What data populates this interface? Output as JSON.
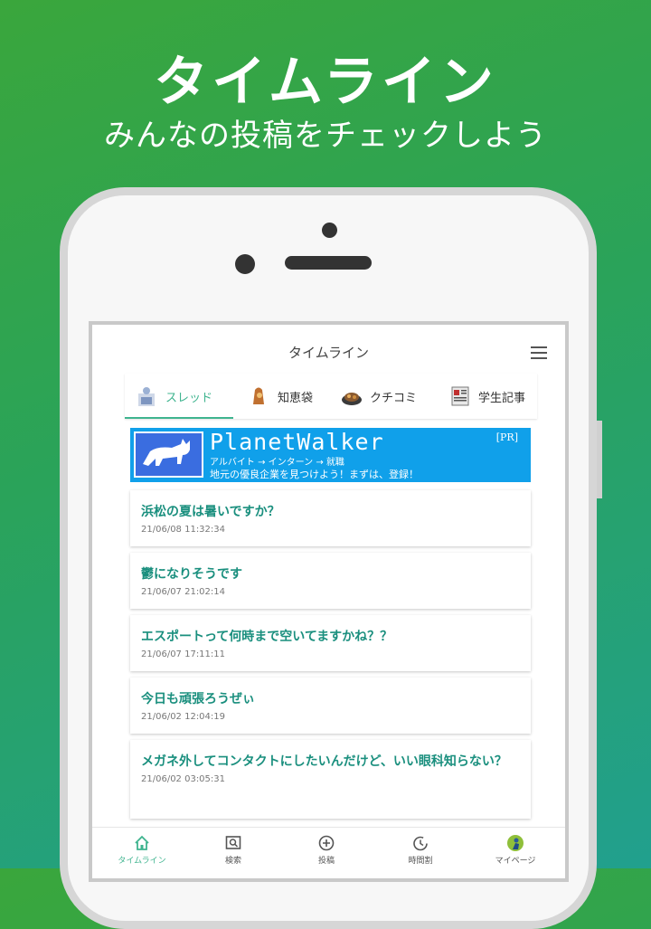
{
  "promo": {
    "title": "タイムライン",
    "subtitle": "みんなの投稿をチェックしよう"
  },
  "appbar": {
    "title": "タイムライン",
    "menu_icon": "hamburger-menu-icon"
  },
  "tabs": [
    {
      "label": "スレッド",
      "icon": "thread-icon",
      "active": true
    },
    {
      "label": "知恵袋",
      "icon": "wisdom-bag-icon",
      "active": false
    },
    {
      "label": "クチコミ",
      "icon": "review-icon",
      "active": false
    },
    {
      "label": "学生記事",
      "icon": "student-article-icon",
      "active": false
    }
  ],
  "banner": {
    "name": "PlanetWalker",
    "pr": "[PR]",
    "line1": "アルバイト → インターン → 就職",
    "line2": "地元の優良企業を見つけよう！まずは、登録！"
  },
  "posts": [
    {
      "title": "浜松の夏は暑いですか？",
      "date": "21/06/08 11:32:34"
    },
    {
      "title": "鬱になりそうです",
      "date": "21/06/07 21:02:14"
    },
    {
      "title": "エスポートって何時まで空いてますかね？？",
      "date": "21/06/07 17:11:11"
    },
    {
      "title": "今日も頑張ろうぜぃ",
      "date": "21/06/02 12:04:19"
    },
    {
      "title": "メガネ外してコンタクトにしたいんだけど、いい眼科知らない？",
      "date": "21/06/02 03:05:31"
    }
  ],
  "nav": [
    {
      "label": "タイムライン",
      "icon": "home-icon",
      "active": true
    },
    {
      "label": "検索",
      "icon": "search-icon",
      "active": false
    },
    {
      "label": "投稿",
      "icon": "add-post-icon",
      "active": false
    },
    {
      "label": "時間割",
      "icon": "timetable-icon",
      "active": false
    },
    {
      "label": "マイページ",
      "icon": "avatar-icon",
      "active": false
    }
  ],
  "colors": {
    "accent": "#3fb48f",
    "post_title": "#1a8f7e",
    "banner_bg": "#10a0ea"
  }
}
